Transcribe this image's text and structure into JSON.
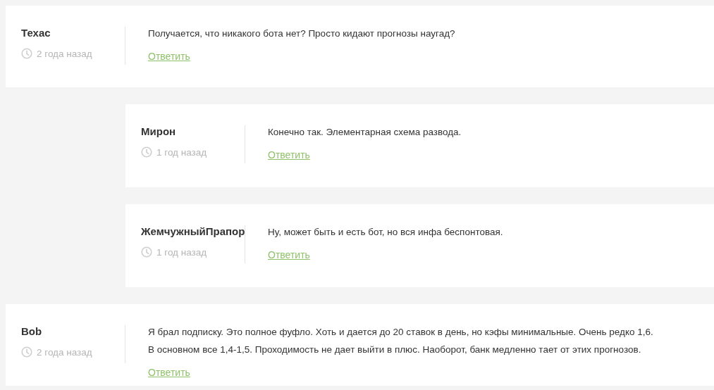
{
  "comments": [
    {
      "author": "Техас",
      "time": "2 года назад",
      "text": "Получается, что никакого бота нет? Просто кидают прогнозы наугад?",
      "reply_link": "Ответить",
      "replies": [
        {
          "author": "Мирон",
          "time": "1 год назад",
          "text": "Конечно так. Элементарная схема развода.",
          "reply_link": "Ответить"
        },
        {
          "author": "ЖемчужныйПрапор",
          "time": "1 год назад",
          "text": "Ну, может быть и есть бот, но вся инфа беспонтовая.",
          "reply_link": "Ответить"
        }
      ]
    },
    {
      "author": "Bob",
      "time": "2 года назад",
      "text": "Я брал подписку. Это полное фуфло. Хоть и дается до 20 ставок в день, но кэфы минимальные. Очень редко 1,6.\nВ основном все 1,4-1,5. Проходимость не дает выйти в плюс. Наоборот, банк медленно тает от этих прогнозов.",
      "reply_link": "Ответить"
    }
  ]
}
